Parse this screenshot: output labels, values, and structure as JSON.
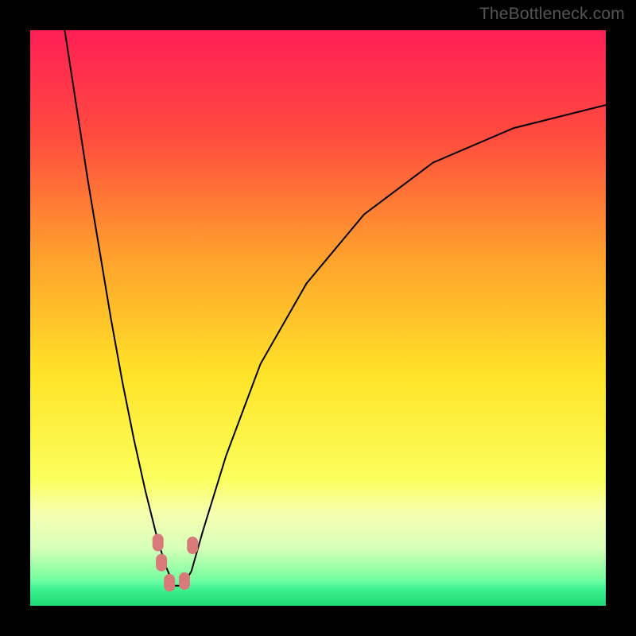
{
  "watermark": "TheBottleneck.com",
  "colors": {
    "frame_bg": "#000000",
    "curve": "#000000",
    "marker": "#d97a7a",
    "gradient_stops": [
      {
        "pct": 0,
        "color": "#ff1f55"
      },
      {
        "pct": 18,
        "color": "#ff4a3f"
      },
      {
        "pct": 40,
        "color": "#ffa32c"
      },
      {
        "pct": 60,
        "color": "#ffe428"
      },
      {
        "pct": 78,
        "color": "#fbff5d"
      },
      {
        "pct": 84,
        "color": "#f6ffb0"
      },
      {
        "pct": 90,
        "color": "#d6ffb8"
      },
      {
        "pct": 95,
        "color": "#7dffa0"
      },
      {
        "pct": 100,
        "color": "#25e27a"
      }
    ],
    "bottom_band": {
      "top_pct": 95.5,
      "height_pct": 4.5,
      "gradient_stops": [
        {
          "pct": 0,
          "color": "#74ffa8"
        },
        {
          "pct": 40,
          "color": "#3af08e"
        },
        {
          "pct": 100,
          "color": "#1fd873"
        }
      ]
    }
  },
  "chart_data": {
    "type": "line",
    "title": "",
    "xlabel": "",
    "ylabel": "",
    "xlim": [
      0,
      100
    ],
    "ylim": [
      0,
      100
    ],
    "series": [
      {
        "name": "bottleneck-curve",
        "x": [
          6,
          8,
          10,
          12,
          14,
          16,
          18,
          20,
          22,
          23.5,
          25,
          26.5,
          28,
          30,
          34,
          40,
          48,
          58,
          70,
          84,
          100
        ],
        "y": [
          100,
          87,
          74,
          62,
          50,
          39,
          29,
          20,
          12,
          7,
          3.5,
          3.5,
          6,
          13,
          26,
          42,
          56,
          68,
          77,
          83,
          87
        ]
      }
    ],
    "markers": [
      {
        "name": "descent-near-min-upper",
        "x": 22.2,
        "y": 11.0
      },
      {
        "name": "descent-near-min-lower",
        "x": 22.8,
        "y": 7.5
      },
      {
        "name": "valley-floor-left",
        "x": 24.2,
        "y": 4.0
      },
      {
        "name": "valley-floor-right",
        "x": 26.8,
        "y": 4.3
      },
      {
        "name": "ascent-near-min",
        "x": 28.2,
        "y": 10.5
      }
    ]
  }
}
